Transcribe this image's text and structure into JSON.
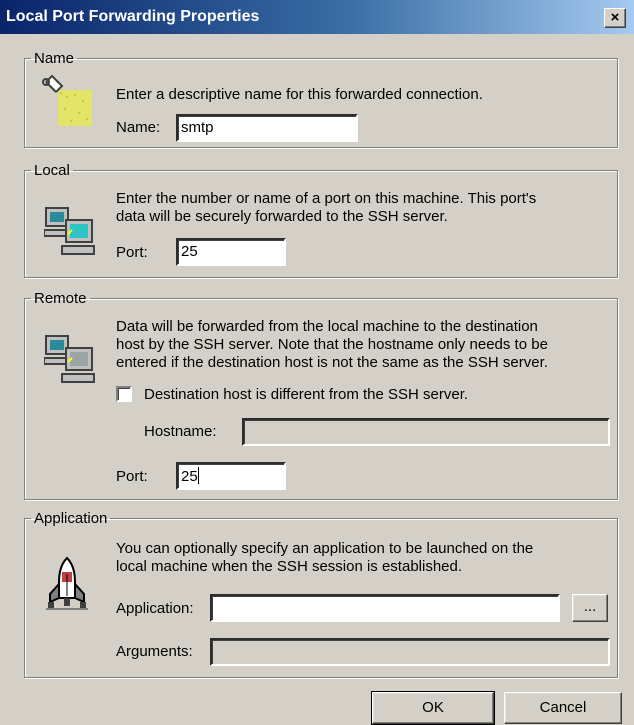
{
  "window": {
    "title": "Local Port Forwarding Properties",
    "close_label": "×"
  },
  "name_group": {
    "legend": "Name",
    "description": "Enter a descriptive name for this forwarded connection.",
    "name_label": "Name:",
    "name_value": "smtp"
  },
  "local_group": {
    "legend": "Local",
    "description_line1": "Enter the number or name of a port on this machine.  This port's",
    "description_line2": "data will be securely forwarded to the SSH server.",
    "port_label": "Port:",
    "port_value": "25"
  },
  "remote_group": {
    "legend": "Remote",
    "description_line1": "Data will be forwarded from the local machine to the destination",
    "description_line2": "host by the SSH server.  Note that the hostname only needs to be",
    "description_line3": "entered if the destination host is not the same as the SSH server.",
    "checkbox_label": "Destination host is different from the SSH server.",
    "checkbox_checked": false,
    "hostname_label": "Hostname:",
    "hostname_value": "",
    "port_label": "Port:",
    "port_value": "25"
  },
  "application_group": {
    "legend": "Application",
    "description_line1": "You can optionally specify an application to be launched on the",
    "description_line2": "local machine when the SSH session is established.",
    "application_label": "Application:",
    "application_value": "",
    "browse_label": "...",
    "arguments_label": "Arguments:",
    "arguments_value": ""
  },
  "buttons": {
    "ok": "OK",
    "cancel": "Cancel"
  },
  "colors": {
    "title_start": "#0a246a",
    "title_end": "#a6caf0",
    "face": "#d4d0c8"
  }
}
